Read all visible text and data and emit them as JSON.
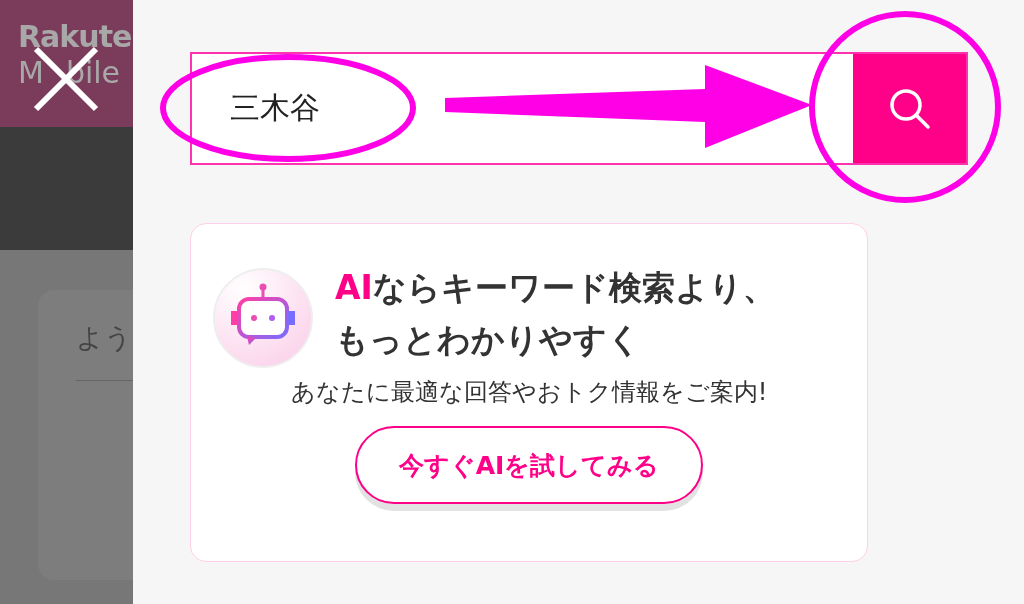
{
  "background_page": {
    "logo_lines": [
      [
        "Rakute"
      ],
      [
        "M",
        "bile"
      ]
    ],
    "card_text": "よう"
  },
  "search": {
    "value": "三木谷"
  },
  "ai_card": {
    "title_highlight": "AI",
    "title_lines": [
      "ならキーワード検索より、",
      "もっとわかりやすく"
    ],
    "description": "あなたに最適な回答やおトク情報をご案内!",
    "button": "今すぐAIを試してみる"
  },
  "annotations": [
    {
      "kind": "ellipse"
    },
    {
      "kind": "arrow"
    },
    {
      "kind": "circle"
    }
  ]
}
